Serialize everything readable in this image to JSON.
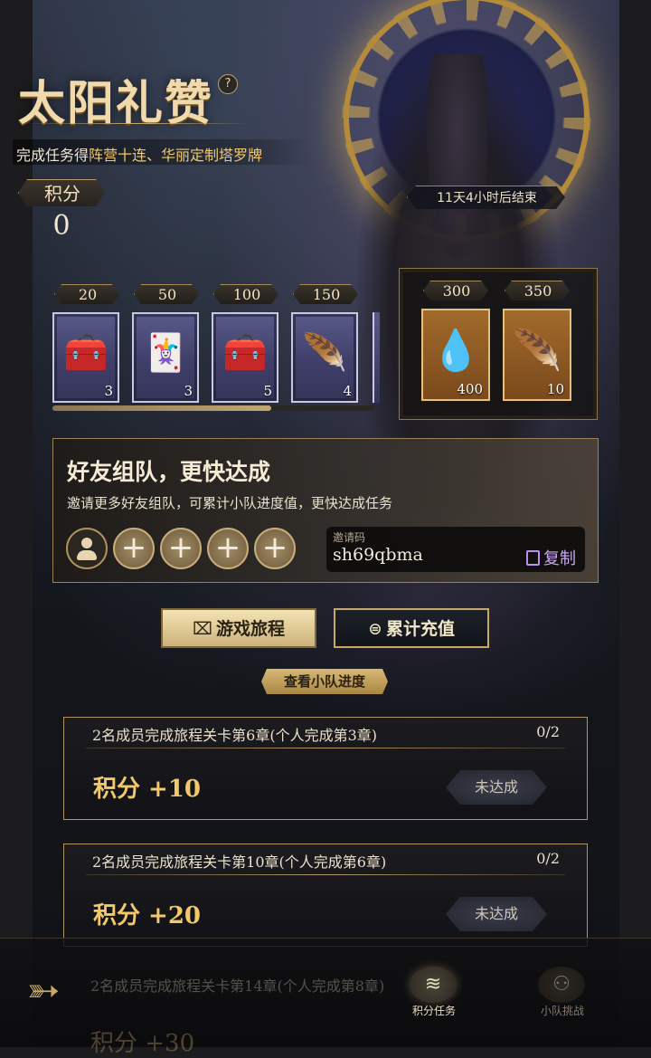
{
  "event": {
    "title": "太阳礼赞",
    "help_icon": "question-icon",
    "subtitle_prefix": "完成任务得",
    "subtitle_highlight": "阵营十连、华丽定制塔罗牌",
    "countdown": "11天4小时后结束"
  },
  "score": {
    "label": "积分",
    "value": "0"
  },
  "rewards": {
    "progress_fraction": 0.68,
    "tiers": [
      {
        "threshold": "20",
        "icon": "treasure-chest-icon",
        "glyph": "🧰",
        "count": "3"
      },
      {
        "threshold": "50",
        "icon": "tarot-card-icon",
        "glyph": "🃏",
        "count": "3"
      },
      {
        "threshold": "100",
        "icon": "treasure-chest-icon",
        "glyph": "🧰",
        "count": "5"
      },
      {
        "threshold": "150",
        "icon": "feather-icon",
        "glyph": "🪶",
        "count": "4"
      }
    ],
    "big_tiers": [
      {
        "threshold": "300",
        "icon": "crystal-icon",
        "glyph": "💧",
        "count": "400"
      },
      {
        "threshold": "350",
        "icon": "golden-feather-icon",
        "glyph": "🪶",
        "count": "10"
      }
    ]
  },
  "team": {
    "title": "好友组队，更快达成",
    "description": "邀请更多好友组队，可累计小队进度值，更快达成任务",
    "add_symbol": "+",
    "invite_label": "邀请码",
    "invite_code": "sh69qbma",
    "copy_label": "复制"
  },
  "buttons": {
    "journey": "游戏旅程",
    "recharge": "累计充值",
    "team_progress": "查看小队进度"
  },
  "tasks": [
    {
      "title": "2名成员完成旅程关卡第6章(个人完成第3章)",
      "progress": "0/2",
      "points": "积分 +10",
      "status": "未达成"
    },
    {
      "title": "2名成员完成旅程关卡第10章(个人完成第6章)",
      "progress": "0/2",
      "points": "积分 +20",
      "status": "未达成"
    },
    {
      "title": "2名成员完成旅程关卡第14章(个人完成第8章)",
      "progress": "",
      "points": "积分 +30",
      "status": ""
    }
  ],
  "nav": {
    "back_icon": "back-arrow-icon",
    "tabs": [
      {
        "label": "积分任务",
        "icon": "coin-stack-icon",
        "active": true
      },
      {
        "label": "小队挑战",
        "icon": "team-icon",
        "active": false
      }
    ]
  },
  "colors": {
    "accent_gold": "#f2c86a",
    "border_gold": "#b09463",
    "highlight_text": "#f2c86a"
  }
}
